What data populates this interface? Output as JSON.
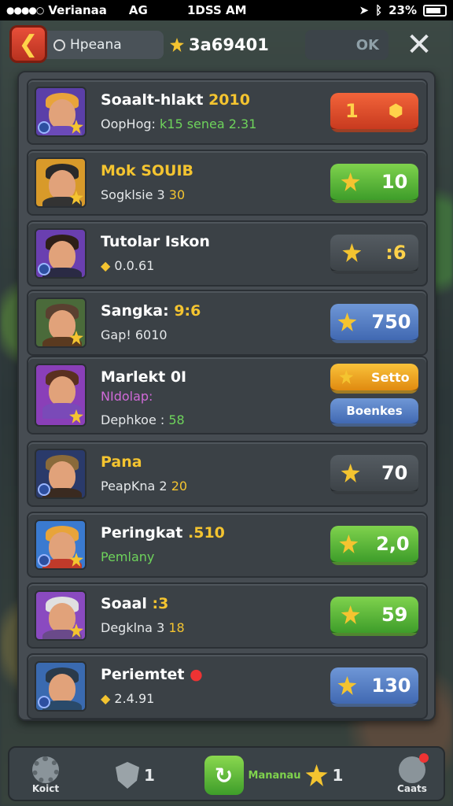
{
  "status_bar": {
    "carrier": "Verianaa",
    "network": "AG",
    "time": "1DSS AM",
    "battery": "23%"
  },
  "top_bar": {
    "search_placeholder": "Hpeana",
    "coins": "3a69401",
    "ok_label": "OK"
  },
  "rows": [
    {
      "name": "Soaalt-hlakt",
      "name_extra": "2010",
      "sub": "OopHog:",
      "sub_g": "k15",
      "sub_rest": "senea 2.31",
      "pill_label": "1",
      "pill_style": "red"
    },
    {
      "name": "Mok SOUIB",
      "name_extra": "",
      "sub": "Sogklsie 3",
      "sub_y": "30",
      "pill_label": "10",
      "pill_style": "green"
    },
    {
      "name": "Tutolar Iskon",
      "name_extra": "",
      "sub": "0.0.61",
      "pill_label": ":6",
      "pill_style": "dark"
    },
    {
      "name": "Sangka:",
      "name_extra": "9:6",
      "sub": "Gap! 6010",
      "pill_label": "750",
      "pill_style": "blue"
    },
    {
      "name": "Marlekt 0I",
      "name_extra": "",
      "sub_pink": "NIdolap:",
      "sub": "Dephkoe :",
      "sub_g": "58",
      "pill_label": "Setto",
      "pill2_label": "Boenkes",
      "pill_style": "orange"
    },
    {
      "name": "Pana",
      "name_extra": "",
      "sub": "PeapKna 2",
      "sub_y": "20",
      "pill_label": "70",
      "pill_style": "dark"
    },
    {
      "name": "Peringkat",
      "name_extra": ".510",
      "sub_green": "Pemlany",
      "pill_label": "2,0",
      "pill_style": "green"
    },
    {
      "name": "Soaal",
      "name_extra": ":3",
      "sub": "Degklna 3",
      "sub_y": "18",
      "pill_label": "59",
      "pill_style": "green"
    },
    {
      "name": "Periemtet",
      "name_extra": "",
      "sub": "2.4.91",
      "pill_label": "130",
      "pill_style": "blue"
    }
  ],
  "bottom_nav": {
    "settings_label": "Koict",
    "shield_count": "1",
    "home_label": "Mananau",
    "home_count": "1",
    "profile_label": "Caats"
  }
}
